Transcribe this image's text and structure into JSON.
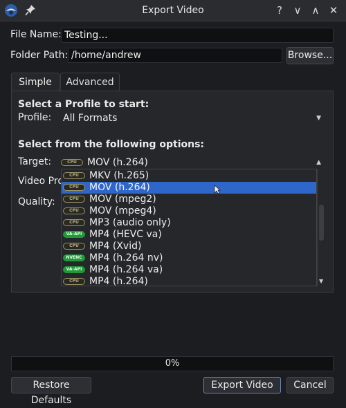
{
  "window": {
    "title": "Export Video",
    "buttons": [
      "?",
      "∨",
      "∧",
      "✕"
    ]
  },
  "file_name": {
    "label": "File Name:",
    "value": "Testing..."
  },
  "folder_path": {
    "label": "Folder Path:",
    "value": "/home/andrew",
    "browse_label": "Browse..."
  },
  "tabs": [
    {
      "label": "Simple"
    },
    {
      "label": "Advanced"
    }
  ],
  "simple": {
    "profile_heading": "Select a Profile to start:",
    "profile_label": "Profile:",
    "profile_value": "All Formats",
    "options_heading": "Select from the following options:",
    "target_label": "Target:",
    "target_value": "MOV (h.264)",
    "target_badge": "CPU",
    "video_profile_label": "Video Pro",
    "quality_label": "Quality:"
  },
  "dropdown_options": [
    {
      "badge": "CPU",
      "label": "MKV (h.265)"
    },
    {
      "badge": "CPU",
      "label": "MOV (h.264)",
      "selected": true
    },
    {
      "badge": "CPU",
      "label": "MOV (mpeg2)"
    },
    {
      "badge": "CPU",
      "label": "MOV (mpeg4)"
    },
    {
      "badge": "CPU",
      "label": "MP3 (audio only)"
    },
    {
      "badge": "VA-API",
      "label": "MP4 (HEVC va)"
    },
    {
      "badge": "CPU",
      "label": "MP4 (Xvid)"
    },
    {
      "badge": "NVENC",
      "label": "MP4 (h.264 nv)"
    },
    {
      "badge": "VA-API",
      "label": "MP4 (h.264 va)"
    },
    {
      "badge": "CPU",
      "label": "MP4 (h.264)"
    }
  ],
  "progress": {
    "percent": 0,
    "label": "0%"
  },
  "footer": {
    "restore_label": "Restore Defaults",
    "export_label": "Export Video",
    "cancel_label": "Cancel"
  },
  "colors": {
    "accent": "#2f66c9",
    "badge_gpu": "#1e9a36"
  }
}
